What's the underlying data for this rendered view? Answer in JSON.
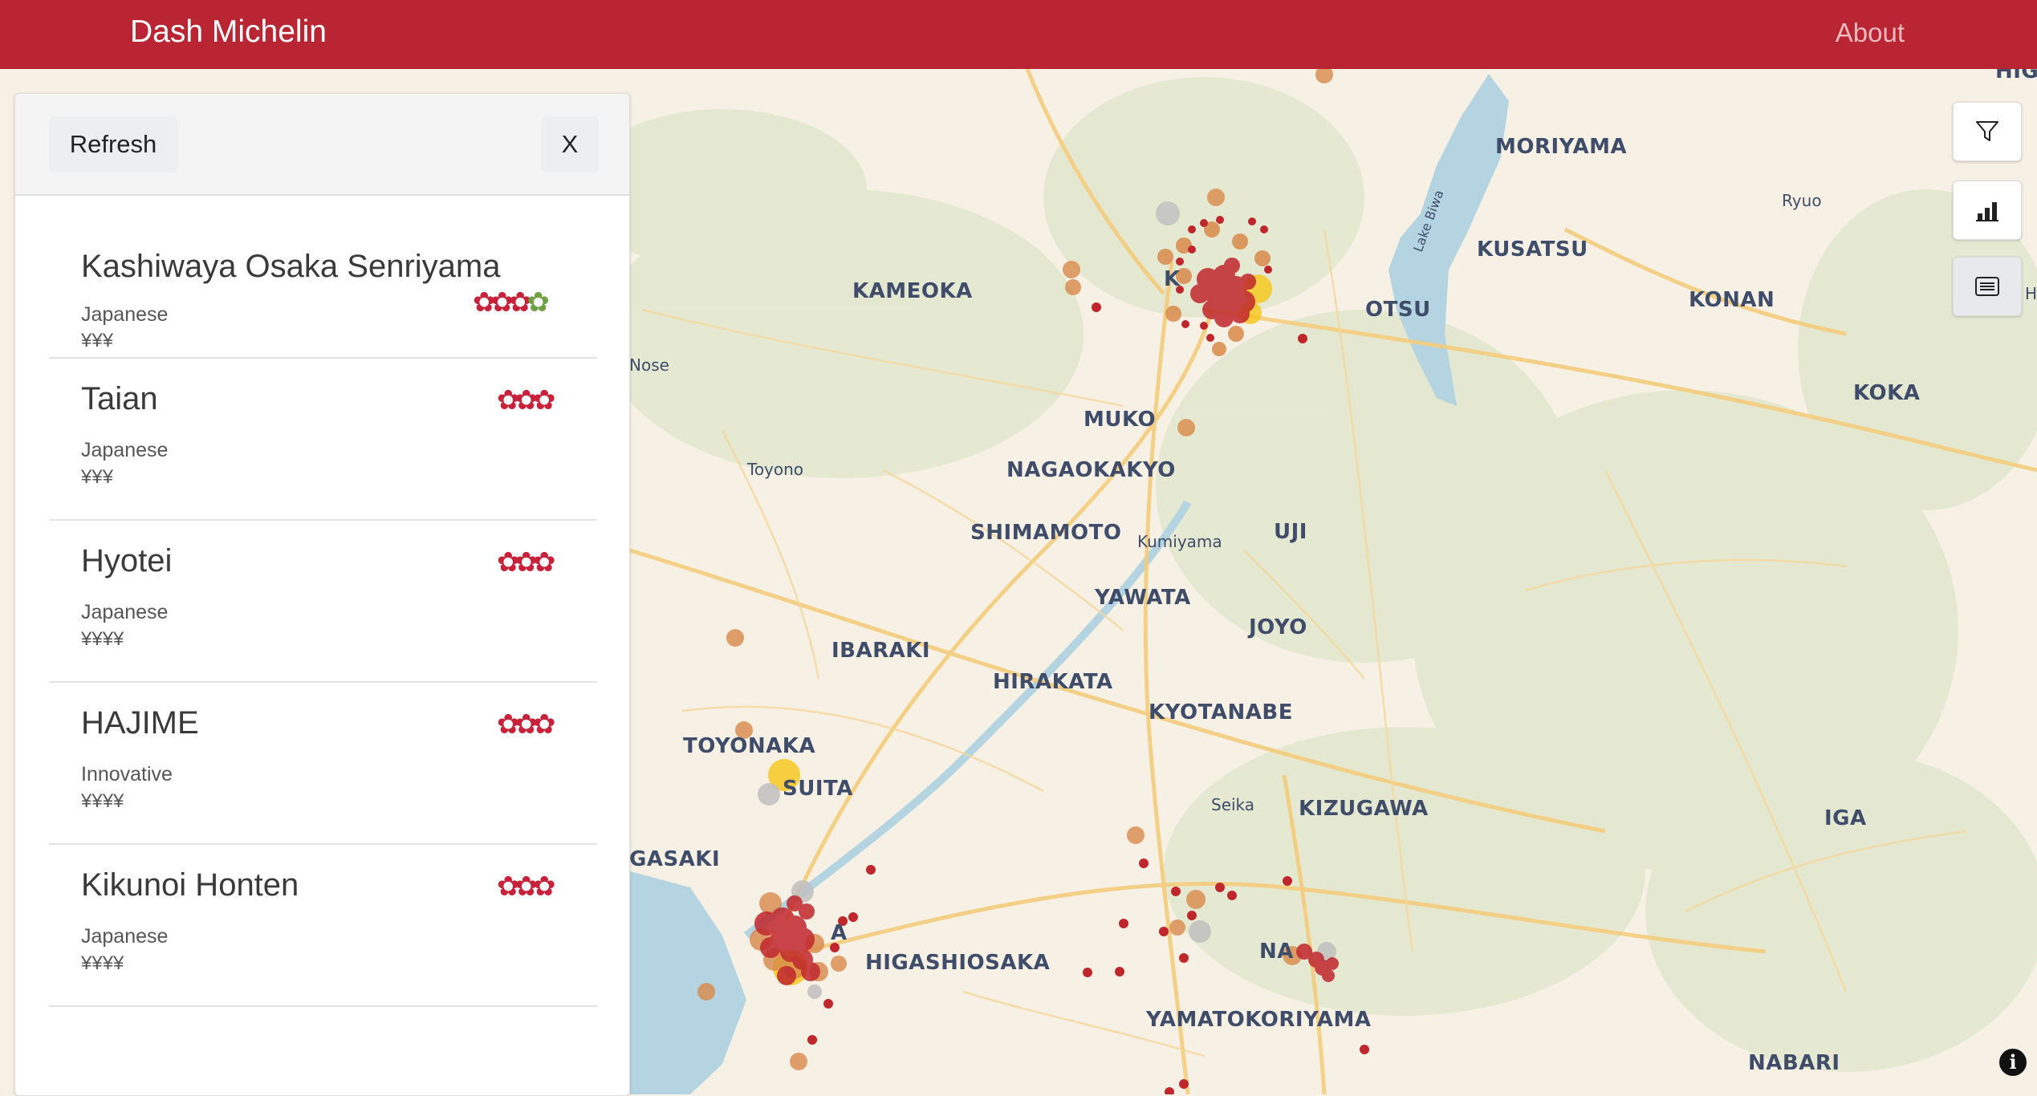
{
  "app": {
    "title": "Dash Michelin",
    "about_label": "About"
  },
  "panel": {
    "refresh_label": "Refresh",
    "close_label": "X",
    "restaurants": [
      {
        "name": "Kashiwaya Osaka Senriyama",
        "cuisine": "Japanese",
        "price": "¥¥¥",
        "stars": 3,
        "green_star": true
      },
      {
        "name": "Taian",
        "cuisine": "Japanese",
        "price": "¥¥¥",
        "stars": 3,
        "green_star": false
      },
      {
        "name": "Hyotei",
        "cuisine": "Japanese",
        "price": "¥¥¥¥",
        "stars": 3,
        "green_star": false
      },
      {
        "name": "HAJIME",
        "cuisine": "Innovative",
        "price": "¥¥¥¥",
        "stars": 3,
        "green_star": false
      },
      {
        "name": "Kikunoi Honten",
        "cuisine": "Japanese",
        "price": "¥¥¥¥",
        "stars": 3,
        "green_star": false
      }
    ]
  },
  "map_labels": {
    "moriyama": "MORIYAMA",
    "ryuo": "Ryuo",
    "kusatsu": "KUSATSU",
    "lake_biwa": "Lake Biwa",
    "kameoka": "KAMEOKA",
    "otsu": "OTSU",
    "konan": "KONAN",
    "koka": "KOKA",
    "nose": "Nose",
    "muko": "MUKO",
    "toyono": "Toyono",
    "nagaokakyo": "NAGAOKAKYO",
    "shimamoto": "SHIMAMOTO",
    "kumiyama": "Kumiyama",
    "uji": "UJI",
    "yawata": "YAWATA",
    "joyo": "JOYO",
    "ibaraki": "IBARAKI",
    "hirakata": "HIRAKATA",
    "kyotanabe": "KYOTANABE",
    "toyonaka": "TOYONAKA",
    "suita": "SUITA",
    "seika": "Seika",
    "kizugawa": "KIZUGAWA",
    "iga": "IGA",
    "gasaki": "GASAKI",
    "higashiosaka": "HIGASHIOSAKA",
    "na": "NA",
    "yamatokoriyama": "YAMATOKORIYAMA",
    "nabari": "NABARI",
    "higa": "HIGA",
    "h": "H",
    "a": "A",
    "k": "K"
  },
  "controls": [
    {
      "name": "filter-button",
      "icon": "filter-icon"
    },
    {
      "name": "chart-button",
      "icon": "bar-chart-icon"
    },
    {
      "name": "list-button",
      "icon": "list-icon",
      "active": true
    }
  ],
  "colors": {
    "brand": "#b92533",
    "star": "#c8213a",
    "green_star": "#6fa043"
  }
}
